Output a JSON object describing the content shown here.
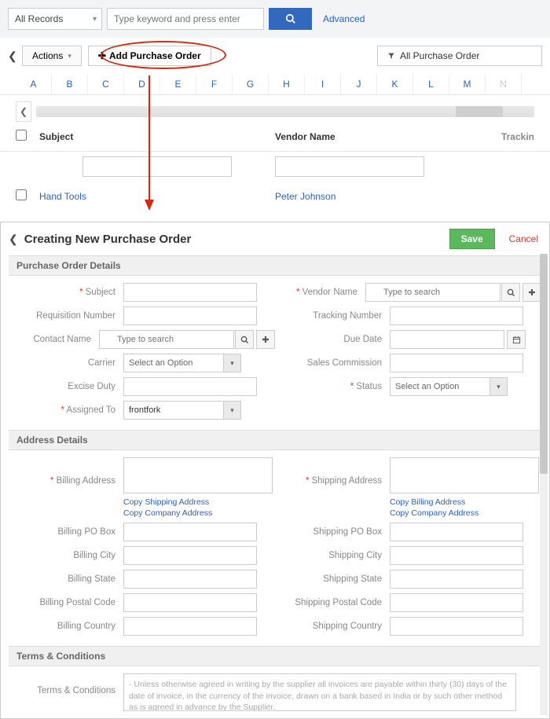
{
  "topbar": {
    "filter": "All Records",
    "search_placeholder": "Type keyword and press enter",
    "advanced": "Advanced"
  },
  "actions": {
    "actions_label": "Actions",
    "add_label": "Add Purchase Order",
    "filter_label": "All Purchase Order"
  },
  "alpha": [
    "A",
    "B",
    "C",
    "D",
    "E",
    "F",
    "G",
    "H",
    "I",
    "J",
    "K",
    "L",
    "M",
    "N"
  ],
  "list": {
    "col_subject": "Subject",
    "col_vendor": "Vendor Name",
    "col_tracking": "Trackin",
    "row1_subject": "Hand Tools",
    "row1_vendor": "Peter Johnson"
  },
  "form": {
    "title": "Creating New Purchase Order",
    "save": "Save",
    "cancel": "Cancel",
    "sec_po": "Purchase Order Details",
    "sec_addr": "Address Details",
    "sec_terms": "Terms & Conditions",
    "labels": {
      "subject": "Subject",
      "req_no": "Requisition Number",
      "contact": "Contact Name",
      "carrier": "Carrier",
      "excise": "Excise Duty",
      "assigned": "Assigned To",
      "vendor": "Vendor Name",
      "tracking": "Tracking Number",
      "due": "Due Date",
      "commission": "Sales Commission",
      "status": "Status",
      "b_addr": "Billing Address",
      "b_po": "Billing PO Box",
      "b_city": "Billing City",
      "b_state": "Billing State",
      "b_postal": "Billing Postal Code",
      "b_country": "Billing Country",
      "s_addr": "Shipping Address",
      "s_po": "Shipping PO Box",
      "s_city": "Shipping City",
      "s_state": "Shipping State",
      "s_postal": "Shipping Postal Code",
      "s_country": "Shipping Country",
      "terms": "Terms & Conditions"
    },
    "placeholders": {
      "type_search": "Type to search",
      "select_option": "Select an Option"
    },
    "values": {
      "assigned": "frontfork",
      "terms": "- Unless otherwise agreed in writing by the supplier all invoices are payable within thirty (30) days of the date of invoice, in the currency of the invoice, drawn on a bank based in India or by such other method as is agreed in advance by the Supplier."
    },
    "links": {
      "copy_ship": "Copy Shipping Address",
      "copy_company": "Copy Company Address",
      "copy_bill": "Copy Billing Address"
    }
  }
}
